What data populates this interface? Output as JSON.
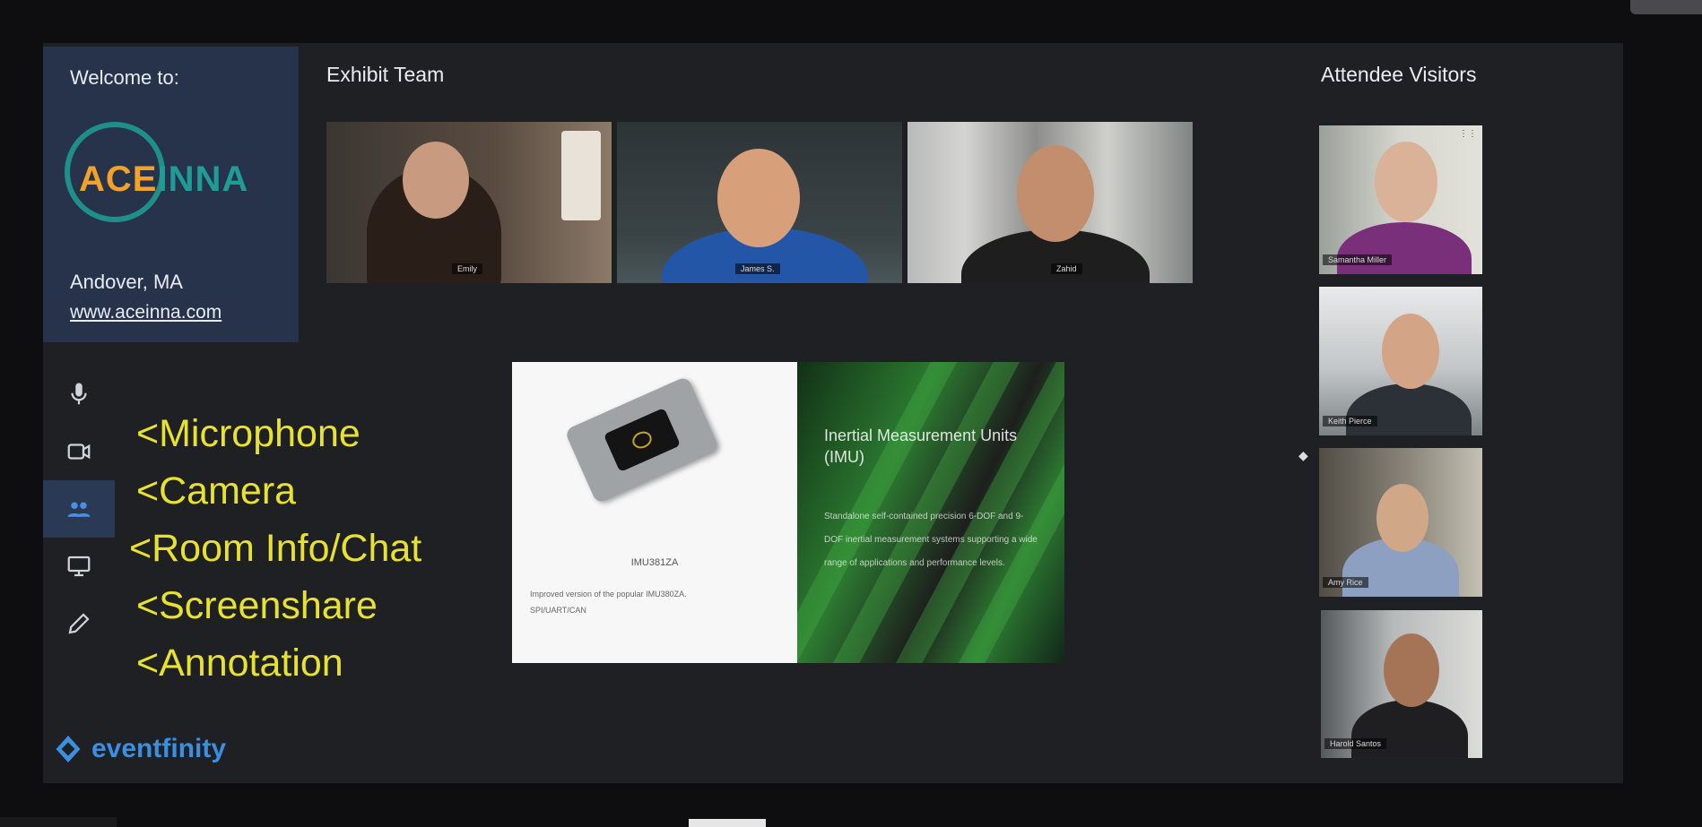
{
  "welcome": {
    "title": "Welcome to:",
    "logo_text_a": "ACE",
    "logo_text_b": "INNA",
    "location": "Andover, MA",
    "url": "www.aceinna.com"
  },
  "exhibit_team": {
    "title": "Exhibit Team",
    "members": [
      {
        "name": "Emily"
      },
      {
        "name": "James S."
      },
      {
        "name": "Zahid"
      }
    ]
  },
  "attendees": {
    "title": "Attendee Visitors",
    "visitors": [
      {
        "name": "Samantha Miller"
      },
      {
        "name": "Keith Pierce"
      },
      {
        "name": "Amy Rice"
      },
      {
        "name": "Harold Santos"
      }
    ]
  },
  "toolbar": {
    "items": [
      {
        "icon": "microphone-icon",
        "hint": "<Microphone"
      },
      {
        "icon": "camera-icon",
        "hint": "<Camera"
      },
      {
        "icon": "people-icon",
        "hint": "<Room Info/Chat"
      },
      {
        "icon": "monitor-icon",
        "hint": "<Screenshare"
      },
      {
        "icon": "pencil-icon",
        "hint": "<Annotation"
      }
    ],
    "active_index": 2
  },
  "brand": {
    "text": "eventfinity"
  },
  "slide": {
    "model": "IMU381ZA",
    "desc_line1": "Improved version of the popular IMU380ZA.",
    "desc_line2": "SPI/UART/CAN",
    "heading": "Inertial Measurement Units (IMU)",
    "body": "Standalone self-contained precision 6-DOF and 9-DOF inertial measurement systems supporting a wide range of applications and performance levels."
  },
  "colors": {
    "hint_yellow": "#e7e22e",
    "panel_blue": "#26334a",
    "brand_blue": "#3a8fe0",
    "logo_orange": "#f4a12a",
    "logo_teal": "#1f9c98"
  }
}
